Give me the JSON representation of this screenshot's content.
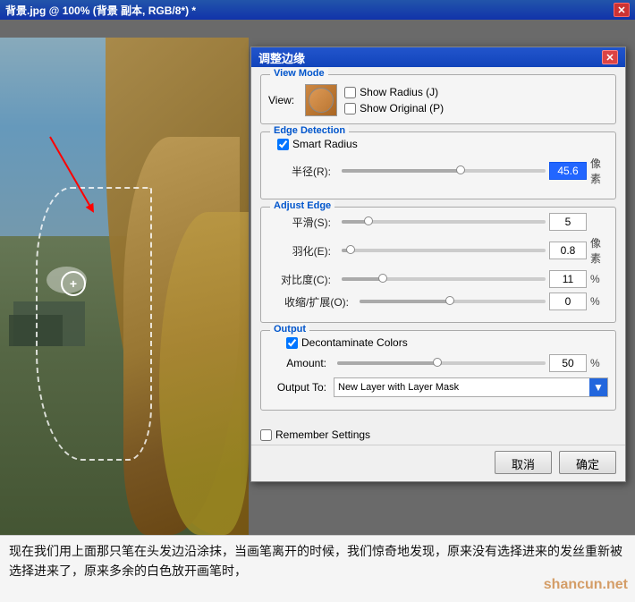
{
  "window": {
    "title": "背景.jpg @ 100% (背景 副本, RGB/8*) *",
    "close_btn": "✕"
  },
  "dialog": {
    "title": "调整边缘",
    "close_btn": "✕",
    "sections": {
      "view_mode": {
        "label": "View Mode",
        "view_label": "View:",
        "show_radius": "Show Radius (J)",
        "show_original": "Show Original (P)"
      },
      "edge_detection": {
        "label": "Edge Detection",
        "smart_radius_label": "Smart Radius",
        "radius_label": "半径(R):",
        "radius_value": "45.6",
        "radius_unit": "像素",
        "slider_pct": 60
      },
      "adjust_edge": {
        "label": "Adjust Edge",
        "smooth_label": "平滑(S):",
        "smooth_value": "5",
        "feather_label": "羽化(E):",
        "feather_value": "0.8",
        "feather_unit": "像素",
        "contrast_label": "对比度(C):",
        "contrast_value": "11",
        "contrast_unit": "%",
        "shift_label": "收缩/扩展(O):",
        "shift_value": "0",
        "shift_unit": "%"
      },
      "output": {
        "label": "Output",
        "decontaminate_label": "Decontaminate Colors",
        "amount_label": "Amount:",
        "amount_value": "50",
        "amount_unit": "%",
        "output_to_label": "Output To:",
        "output_to_value": "New Layer with Layer Mask"
      }
    },
    "remember_label": "Remember Settings",
    "cancel_btn": "取消",
    "ok_btn": "确定"
  },
  "bottom_text": "现在我们用上面那只笔在头发边沿涂抹，当画笔离开的时候，我们惊奇地发现，原来没有选择进来的发丝重新被选择进来了，原来多余的白色放开画笔时，",
  "watermark": "shancun.net"
}
